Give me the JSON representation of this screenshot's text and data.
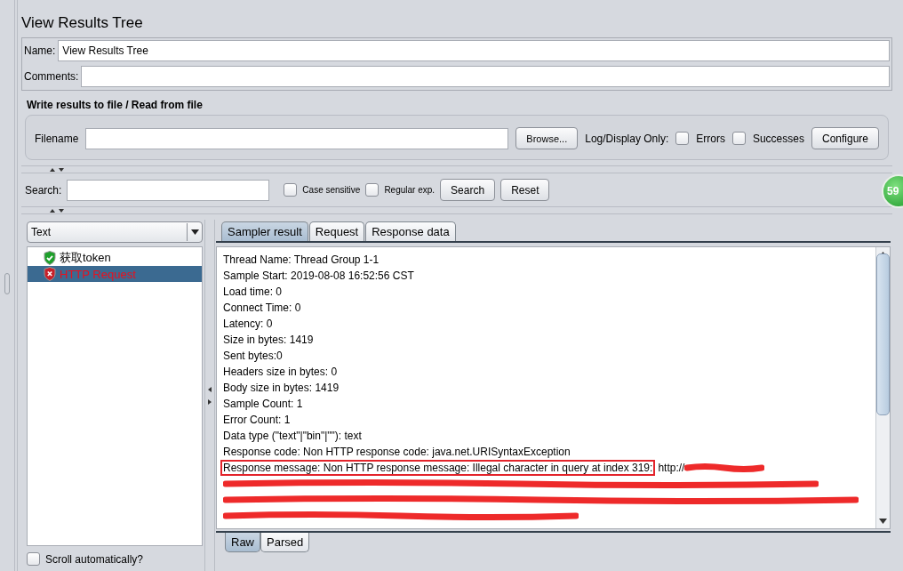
{
  "title": "View Results Tree",
  "name_field": {
    "label": "Name:",
    "value": "View Results Tree"
  },
  "comments_field": {
    "label": "Comments:"
  },
  "file_section": {
    "title": "Write results to file / Read from file",
    "filename_label": "Filename",
    "browse": "Browse...",
    "log_label": "Log/Display Only:",
    "filters": [
      {
        "label": "Errors",
        "checked": false
      },
      {
        "label": "Successes",
        "checked": false
      }
    ],
    "configure": "Configure"
  },
  "search": {
    "label": "Search:",
    "options": [
      {
        "label": "Case sensitive",
        "checked": false
      },
      {
        "label": "Regular exp.",
        "checked": false
      }
    ],
    "buttons": [
      "Search",
      "Reset"
    ]
  },
  "badge": "59",
  "renderer": "Text",
  "tree": [
    {
      "label": "获取token",
      "kind": "success",
      "selected": false
    },
    {
      "label": "HTTP Request",
      "kind": "error",
      "selected": true
    }
  ],
  "scroll_auto": {
    "label": "Scroll automatically?",
    "checked": false
  },
  "tabs": [
    {
      "label": "Sampler result",
      "selected": true
    },
    {
      "label": "Request",
      "selected": false
    },
    {
      "label": "Response data",
      "selected": false
    }
  ],
  "result_lines": [
    {
      "kind": "text",
      "text": "Thread Name: Thread Group 1-1"
    },
    {
      "kind": "text",
      "text": "Sample Start: 2019-08-08 16:52:56 CST"
    },
    {
      "kind": "text",
      "text": "Load time: 0"
    },
    {
      "kind": "text",
      "text": "Connect Time: 0"
    },
    {
      "kind": "text",
      "text": "Latency: 0"
    },
    {
      "kind": "text",
      "text": "Size in bytes: 1419"
    },
    {
      "kind": "text",
      "text": "Sent bytes:0"
    },
    {
      "kind": "text",
      "text": "Headers size in bytes: 0"
    },
    {
      "kind": "text",
      "text": "Body size in bytes: 1419"
    },
    {
      "kind": "text",
      "text": "Sample Count: 1"
    },
    {
      "kind": "text",
      "text": "Error Count: 1"
    },
    {
      "kind": "text",
      "text": "Data type (\"text\"|\"bin\"|\"\"): text"
    },
    {
      "kind": "text",
      "text": "Response code: Non HTTP response code: java.net.URISyntaxException"
    },
    {
      "kind": "boxed",
      "text": "Response message: Non HTTP response message: Illegal character in query at index 319:",
      "tail": "http://"
    },
    {
      "kind": "redacted"
    },
    {
      "kind": "redacted"
    },
    {
      "kind": "redacted"
    }
  ],
  "view_tabs": [
    {
      "label": "Raw",
      "selected": true
    },
    {
      "label": "Parsed",
      "selected": false
    }
  ]
}
